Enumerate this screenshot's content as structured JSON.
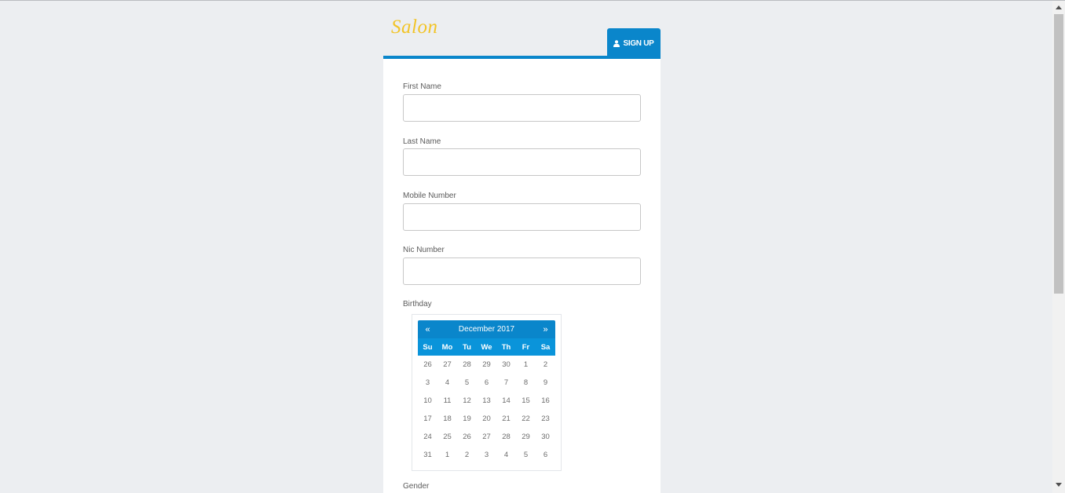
{
  "brand": {
    "logo_text": "Salon",
    "logo_color": "#f2c428"
  },
  "header": {
    "signup_label": "SIGN UP",
    "signup_icon": "user-icon",
    "accent": "#0a86cb"
  },
  "form": {
    "first_name_label": "First Name",
    "first_name_value": "",
    "last_name_label": "Last Name",
    "last_name_value": "",
    "mobile_label": "Mobile Number",
    "mobile_value": "",
    "nic_label": "Nic Number",
    "nic_value": "",
    "birthday_label": "Birthday",
    "gender_label": "Gender"
  },
  "datepicker": {
    "prev": "«",
    "next": "»",
    "month_title": "December 2017",
    "weekdays": [
      "Su",
      "Mo",
      "Tu",
      "We",
      "Th",
      "Fr",
      "Sa"
    ],
    "weeks": [
      [
        "26",
        "27",
        "28",
        "29",
        "30",
        "1",
        "2"
      ],
      [
        "3",
        "4",
        "5",
        "6",
        "7",
        "8",
        "9"
      ],
      [
        "10",
        "11",
        "12",
        "13",
        "14",
        "15",
        "16"
      ],
      [
        "17",
        "18",
        "19",
        "20",
        "21",
        "22",
        "23"
      ],
      [
        "24",
        "25",
        "26",
        "27",
        "28",
        "29",
        "30"
      ],
      [
        "31",
        "1",
        "2",
        "3",
        "4",
        "5",
        "6"
      ]
    ]
  }
}
